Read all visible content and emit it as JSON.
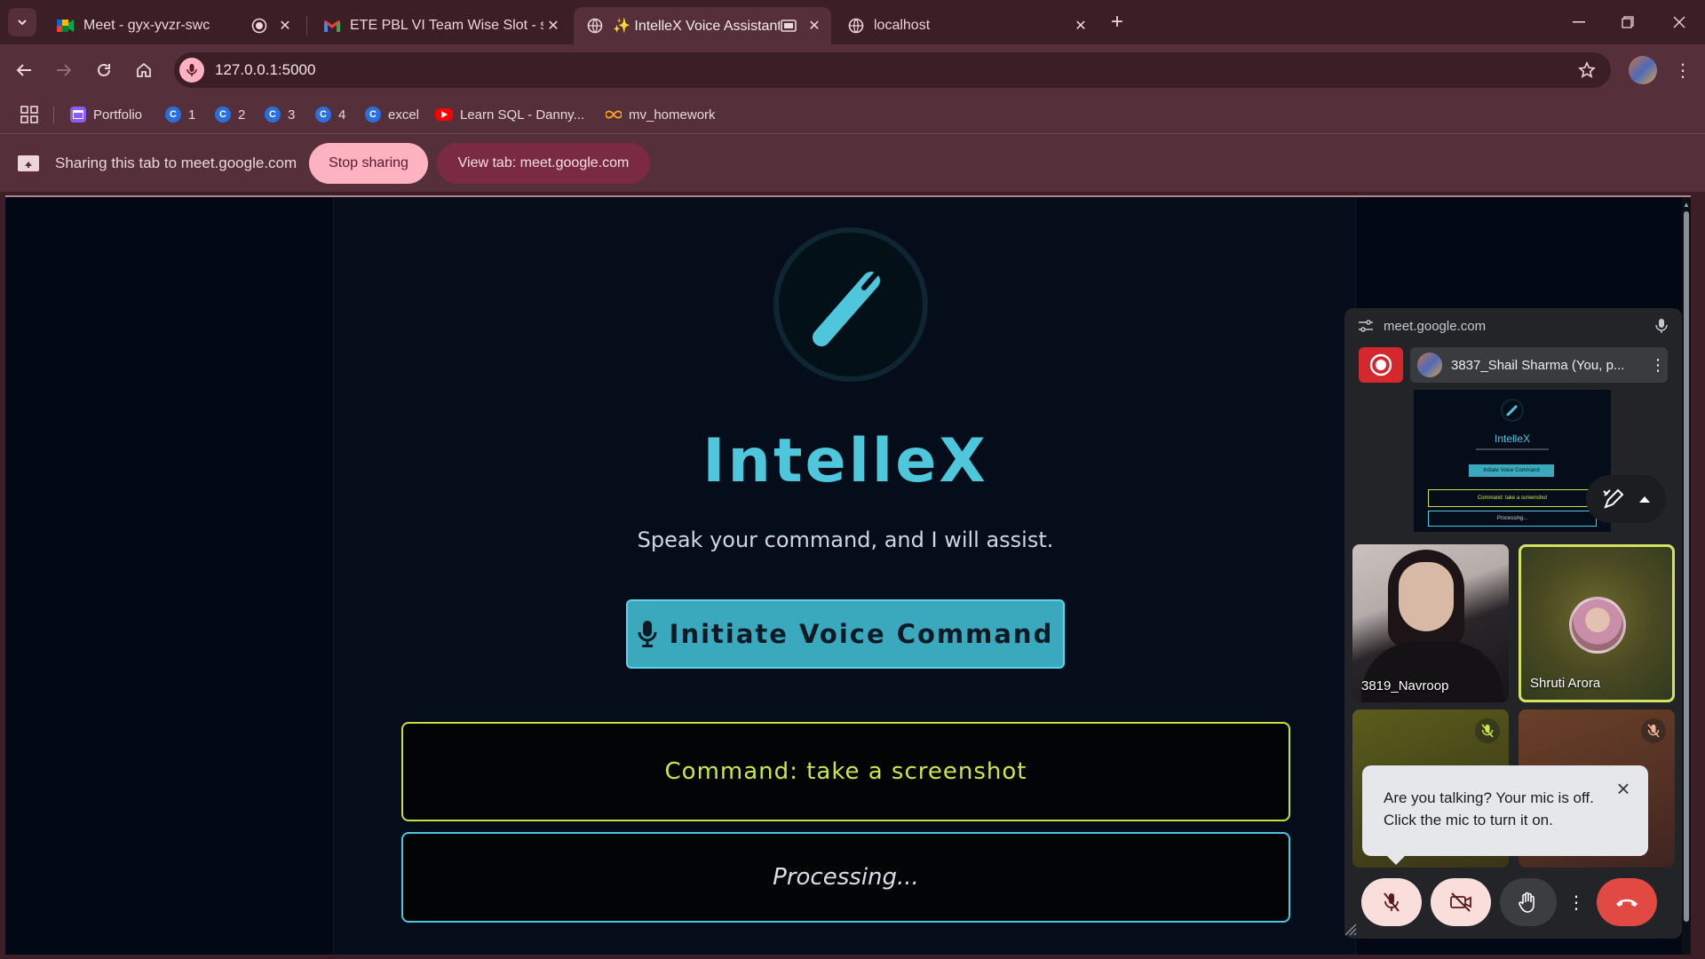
{
  "tabs": [
    {
      "title": "Meet - gyx-yvzr-swc",
      "active": false
    },
    {
      "title": "ETE PBL VI Team Wise Slot - sha",
      "active": false
    },
    {
      "title": "✨ IntelleX Voice Assistant",
      "active": true
    },
    {
      "title": "localhost",
      "active": false
    }
  ],
  "omnibox": {
    "url": "127.0.0.1:5000"
  },
  "bookmarks": [
    {
      "label": "Portfolio",
      "icon": "portfolio-icon"
    },
    {
      "label": "1",
      "icon": "c-icon"
    },
    {
      "label": "2",
      "icon": "c-icon"
    },
    {
      "label": "3",
      "icon": "c-icon"
    },
    {
      "label": "4",
      "icon": "c-icon"
    },
    {
      "label": "excel",
      "icon": "c-icon"
    },
    {
      "label": "Learn SQL - Danny...",
      "icon": "youtube-icon"
    },
    {
      "label": "mv_homework",
      "icon": "infinity-icon"
    }
  ],
  "sharing": {
    "text": "Sharing this tab to meet.google.com",
    "stop_label": "Stop sharing",
    "view_label": "View tab: meet.google.com"
  },
  "app": {
    "title": "IntelleX",
    "subtitle": "Speak your command, and I will assist.",
    "button_label": "Initiate Voice Command",
    "command_text": "Command: take a screenshot",
    "status_text": "Processing...",
    "colors": {
      "accent": "#4ec7dd",
      "command": "#c9e845",
      "background": "#050d1a"
    }
  },
  "meet": {
    "host": "meet.google.com",
    "presenter": "3837_Shail Sharma (You, p...",
    "preview": {
      "title": "IntelleX",
      "button": "Initiate Voice Command",
      "command": "Command: take a screenshot",
      "status": "Processing..."
    },
    "participants": [
      {
        "name": "3819_Navroop"
      },
      {
        "name": "Shruti Arora"
      }
    ],
    "toast": "Are you talking? Your mic is off. Click the mic to turn it on."
  }
}
